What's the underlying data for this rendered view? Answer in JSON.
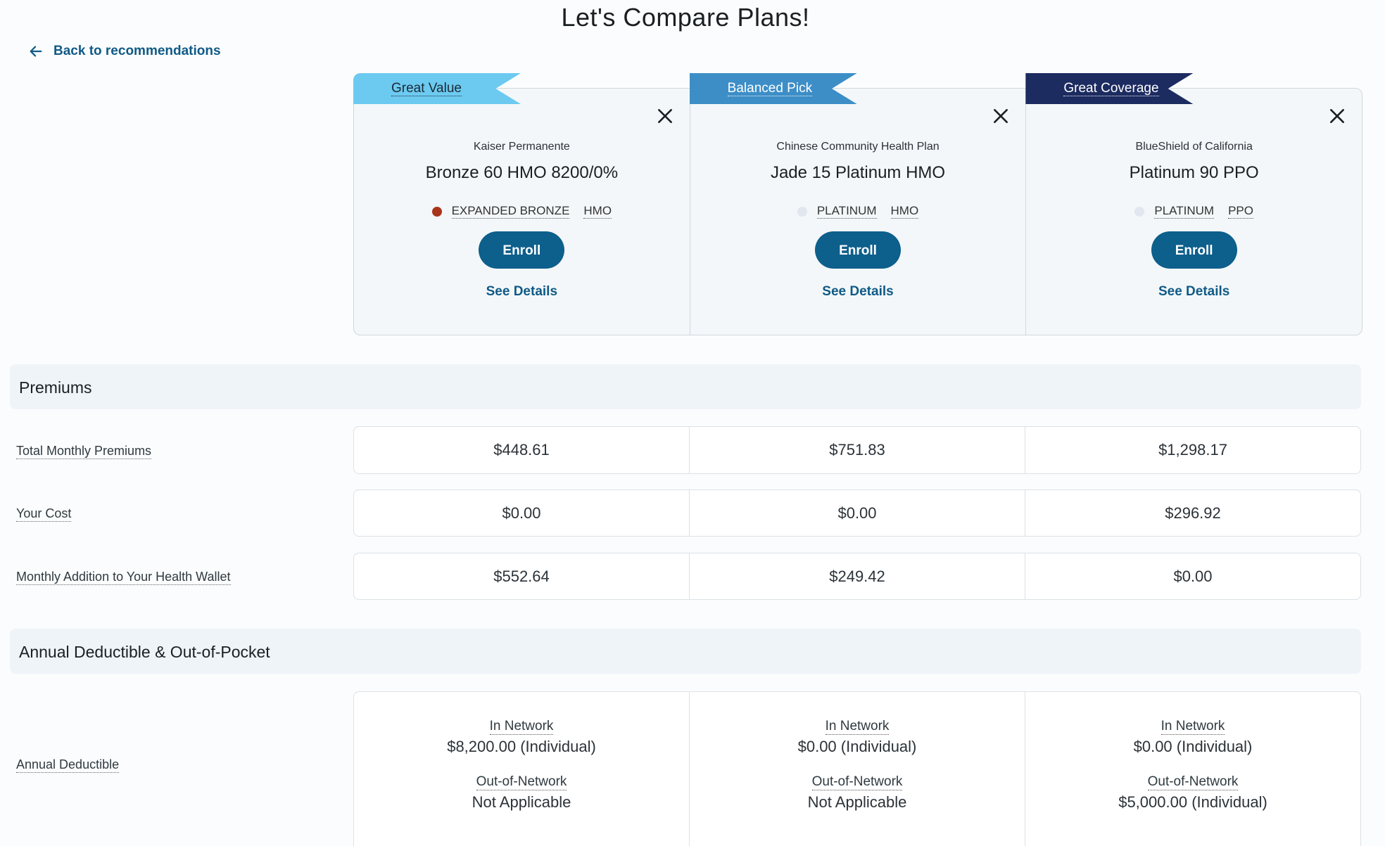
{
  "page": {
    "title": "Let's Compare Plans!",
    "back_label": "Back to recommendations"
  },
  "plans": [
    {
      "ribbon": "Great Value",
      "ribbon_color": "#6ccaf0",
      "ribbon_text_color": "#1a2a36",
      "carrier": "Kaiser Permanente",
      "name": "Bronze 60 HMO 8200/0%",
      "metal": "EXPANDED BRONZE",
      "metal_dot_color": "#a8341c",
      "network": "HMO",
      "enroll_label": "Enroll",
      "details_label": "See Details"
    },
    {
      "ribbon": "Balanced Pick",
      "ribbon_color": "#3d8ec7",
      "ribbon_text_color": "#ffffff",
      "carrier": "Chinese Community Health Plan",
      "name": "Jade 15 Platinum HMO",
      "metal": "PLATINUM",
      "metal_dot_color": "#e2e6ef",
      "network": "HMO",
      "enroll_label": "Enroll",
      "details_label": "See Details"
    },
    {
      "ribbon": "Great Coverage",
      "ribbon_color": "#1c2b60",
      "ribbon_text_color": "#ffffff",
      "carrier": "BlueShield of California",
      "name": "Platinum 90 PPO",
      "metal": "PLATINUM",
      "metal_dot_color": "#e2e6ef",
      "network": "PPO",
      "enroll_label": "Enroll",
      "details_label": "See Details"
    }
  ],
  "premiums": {
    "title": "Premiums",
    "rows": [
      {
        "label": "Total Monthly Premiums",
        "values": [
          "$448.61",
          "$751.83",
          "$1,298.17"
        ]
      },
      {
        "label": "Your Cost",
        "values": [
          "$0.00",
          "$0.00",
          "$296.92"
        ]
      },
      {
        "label": "Monthly Addition to Your Health Wallet",
        "values": [
          "$552.64",
          "$249.42",
          "$0.00"
        ]
      }
    ]
  },
  "deductible": {
    "title": "Annual Deductible & Out-of-Pocket",
    "row_label": "Annual Deductible",
    "in_network_label": "In Network",
    "out_network_label": "Out-of-Network",
    "plans": [
      {
        "in": "$8,200.00 (Individual)",
        "out": "Not Applicable"
      },
      {
        "in": "$0.00 (Individual)",
        "out": "Not Applicable"
      },
      {
        "in": "$0.00 (Individual)",
        "out": "$5,000.00 (Individual)"
      }
    ]
  }
}
